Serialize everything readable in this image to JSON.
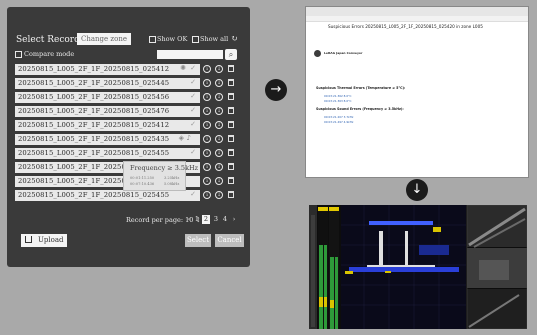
{
  "dialog": {
    "title": "Select Record",
    "change_zone_label": "Change zone",
    "show_ok_label": "Show OK",
    "show_all_label": "Show all",
    "compare_mode_label": "Compare mode",
    "refresh_icon": "refresh-icon",
    "search_icon": "search-icon"
  },
  "records": [
    {
      "name": "20250815_L005_2F_1F_20250815_025412"
    },
    {
      "name": "20250815_L005_2F_1F_20250815_025445"
    },
    {
      "name": "20250815_L005_2F_1F_20250815_025456"
    },
    {
      "name": "20250815_L005_2F_1F_20250815_025476"
    },
    {
      "name": "20250815_L005_2F_1F_20250815_025412"
    },
    {
      "name": "20250815_L005_2F_1F_20250815_025435"
    },
    {
      "name": "20250815_L005_2F_1F_20250815_025455"
    },
    {
      "name": "20250815_L005_2F_1F_20250815_025455"
    },
    {
      "name": "20250815_L005_2F_1F_20250815_025455"
    },
    {
      "name": "20250815_L005_2F_1F_20250815_025455"
    }
  ],
  "tooltip": {
    "title": "Frequency ≥ 3.5kHz",
    "lines": [
      {
        "left": "00:01:11.250",
        "right": "3.25kHz"
      },
      {
        "left": "00:07:10.436",
        "right": "5.08kHz"
      }
    ]
  },
  "pagination": {
    "label": "Record per page:",
    "per_page": "10 ↕",
    "pages": [
      "‹",
      "1",
      "2",
      "3",
      "4",
      "›"
    ],
    "active": "2"
  },
  "buttons": {
    "upload": "Upload",
    "select": "Select",
    "cancel": "Cancel"
  },
  "arrows": {
    "right": "→",
    "down": "↓"
  },
  "email": {
    "subject": "Suspicious Errors 20250815_L005_2F_1F_20250815_025420 in zone L005",
    "sender": "LeRAG Japan Conveyor",
    "section_thermal": "Suspicious Thermal Errors (Temperature ≥ 5°C):",
    "section_sound": "Suspicious Sound Errors (Frequency ≥ 3.5kHz):",
    "thermal_lines": [
      "00:03:21.362   8.0°C",
      "00:03:21.363   8.0°C"
    ],
    "sound_lines": [
      "00:03:21.207   3.7kHz",
      "00:03:21.497   4.9kHz"
    ]
  }
}
